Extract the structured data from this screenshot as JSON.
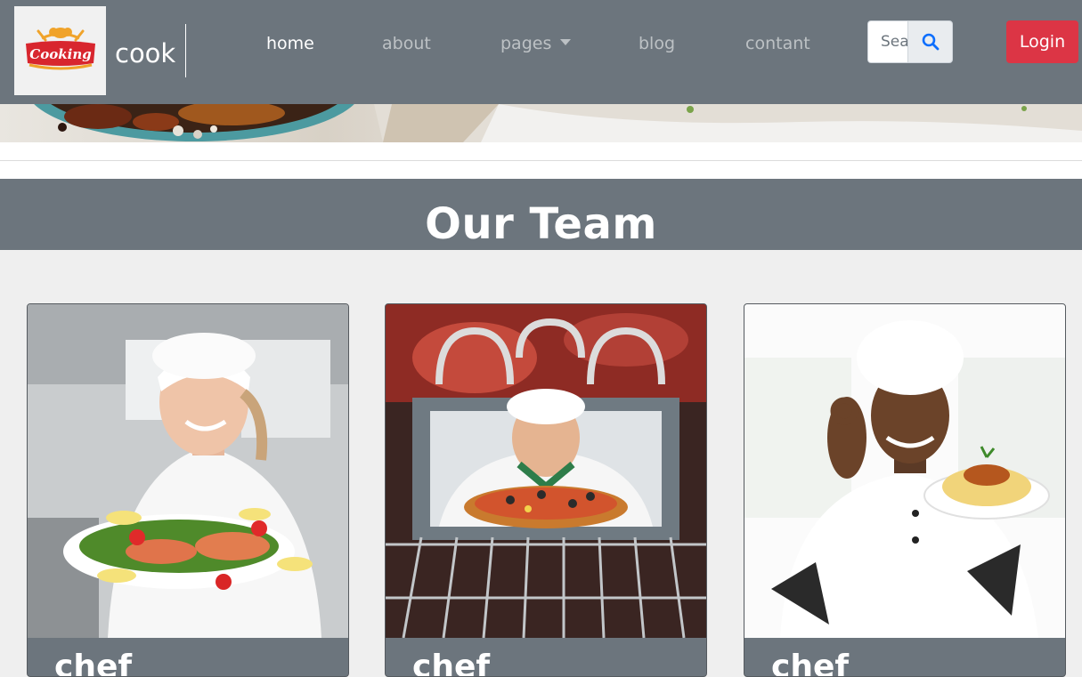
{
  "navbar": {
    "brand": "cook",
    "logo_text": "Cooking",
    "links": [
      {
        "label": "home",
        "active": true
      },
      {
        "label": "about",
        "active": false
      },
      {
        "label": "pages",
        "active": false
      },
      {
        "label": "blog",
        "active": false
      },
      {
        "label": "contant",
        "active": false
      }
    ],
    "search_placeholder": "Search",
    "search_icon": "search-icon",
    "login_label": "Login"
  },
  "team": {
    "title": "Our Team",
    "cards": [
      {
        "caption": "chef",
        "photo": "female-chef-with-salad-plate"
      },
      {
        "caption": "chef",
        "photo": "chef-with-pizza-in-oven"
      },
      {
        "caption": "chef",
        "photo": "chef-with-spaghetti-plate"
      }
    ]
  },
  "colors": {
    "navbar_bg": "#6c757d",
    "login_bg": "#dc3545",
    "search_icon": "#0d6efd",
    "page_bg": "#efefef"
  }
}
